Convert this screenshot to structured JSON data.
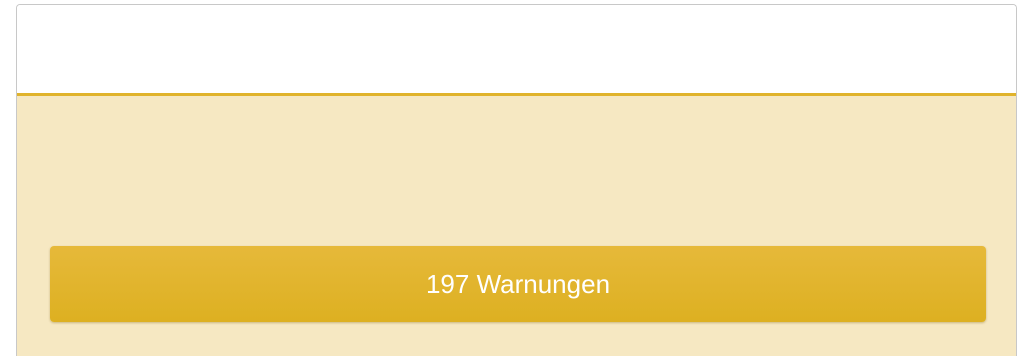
{
  "colors": {
    "accent": "#e0b32c",
    "panel_background": "#f6e8c2",
    "button_background": "#e2b42e",
    "button_text": "#ffffff"
  },
  "warnings": {
    "button_label": "197 Warnungen",
    "count": 197
  }
}
